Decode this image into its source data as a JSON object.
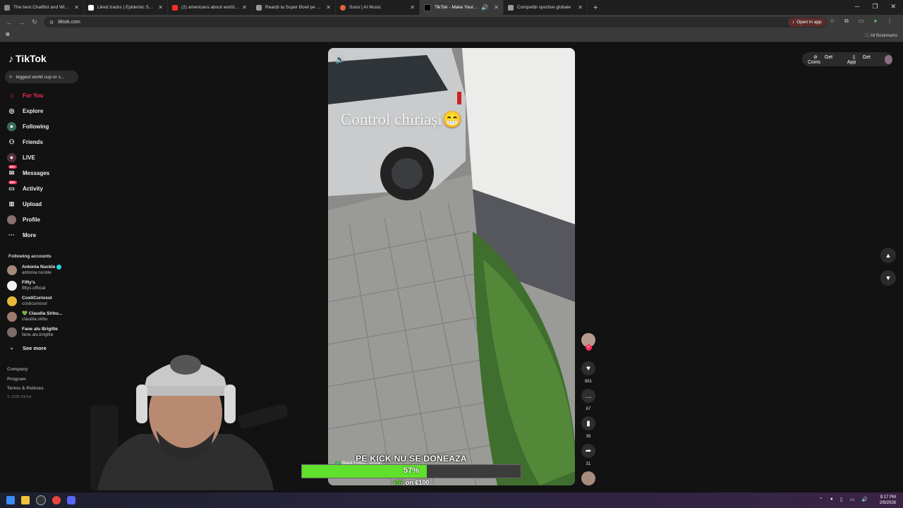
{
  "browser": {
    "tabs": [
      {
        "title": "The best ChatBot and Widgets",
        "color": "#8a8a8a"
      },
      {
        "title": "Liked tracks | Epidemic Sound",
        "color": "#ffffff"
      },
      {
        "title": "(2) americans about world cup",
        "color": "#ff2a2a"
      },
      {
        "title": "Reacții la Super Bowl pe Kick",
        "color": "#9a9a9a"
      },
      {
        "title": "Suno | AI Music",
        "color": "#e0643c"
      },
      {
        "title": "TikTok - Make Your Day",
        "color": "#000000",
        "active": true
      },
      {
        "title": "Competiții sportive globale",
        "color": "#9a9a9a"
      }
    ],
    "url": "tiktok.com",
    "open_in_app": "Open in app",
    "all_bookmarks": "All Bookmarks"
  },
  "tiktok": {
    "logo": "TikTok",
    "search_placeholder": "biggest world cup or s...",
    "nav": [
      {
        "label": "For You",
        "icon": "home-icon"
      },
      {
        "label": "Explore",
        "icon": "compass-icon"
      },
      {
        "label": "Following",
        "icon": "following-icon"
      },
      {
        "label": "Friends",
        "icon": "friends-icon"
      },
      {
        "label": "LIVE",
        "icon": "live-icon"
      },
      {
        "label": "Messages",
        "icon": "messages-icon",
        "badge": "99+"
      },
      {
        "label": "Activity",
        "icon": "activity-icon",
        "badge": "99+"
      },
      {
        "label": "Upload",
        "icon": "upload-icon"
      },
      {
        "label": "Profile",
        "icon": "profile-icon"
      },
      {
        "label": "More",
        "icon": "more-icon"
      }
    ],
    "following_title": "Following accounts",
    "accounts": [
      {
        "name": "Antonia Nuckle",
        "handle": "antonia.nuckle",
        "verified": true,
        "color": "#a58878"
      },
      {
        "name": "Fifty's",
        "handle": "fiftys.official",
        "color": "#f2f2f2"
      },
      {
        "name": "CostiCuriosul",
        "handle": "costicuriosul",
        "color": "#e5b73b"
      },
      {
        "name": "💚 Claudia Sirbu...",
        "handle": "claudia.sirbu",
        "color": "#9c7b6c"
      },
      {
        "name": "Fane alu Brigitte",
        "handle": "fane.alu.brigitte",
        "color": "#7a6b6b"
      }
    ],
    "see_more": "See more",
    "footer": [
      "Company",
      "Program",
      "Terms & Policies"
    ],
    "copyright": "© 2026 TikTok",
    "get_coins": "Get Coins",
    "get_app": "Get App"
  },
  "video": {
    "caption": "Control chiriași😁",
    "music": "Black Forest · Ocean",
    "likes": "881",
    "comments": "67",
    "saves": "39",
    "shares": "31"
  },
  "donation": {
    "title": "PE KICK NU SE DONEAZA",
    "percent_label": "57%",
    "percent": 0.57,
    "raised": "€57",
    "goal_text": "on €100"
  },
  "taskbar": {
    "time": "9:17 PM",
    "date": "2/9/2026"
  }
}
